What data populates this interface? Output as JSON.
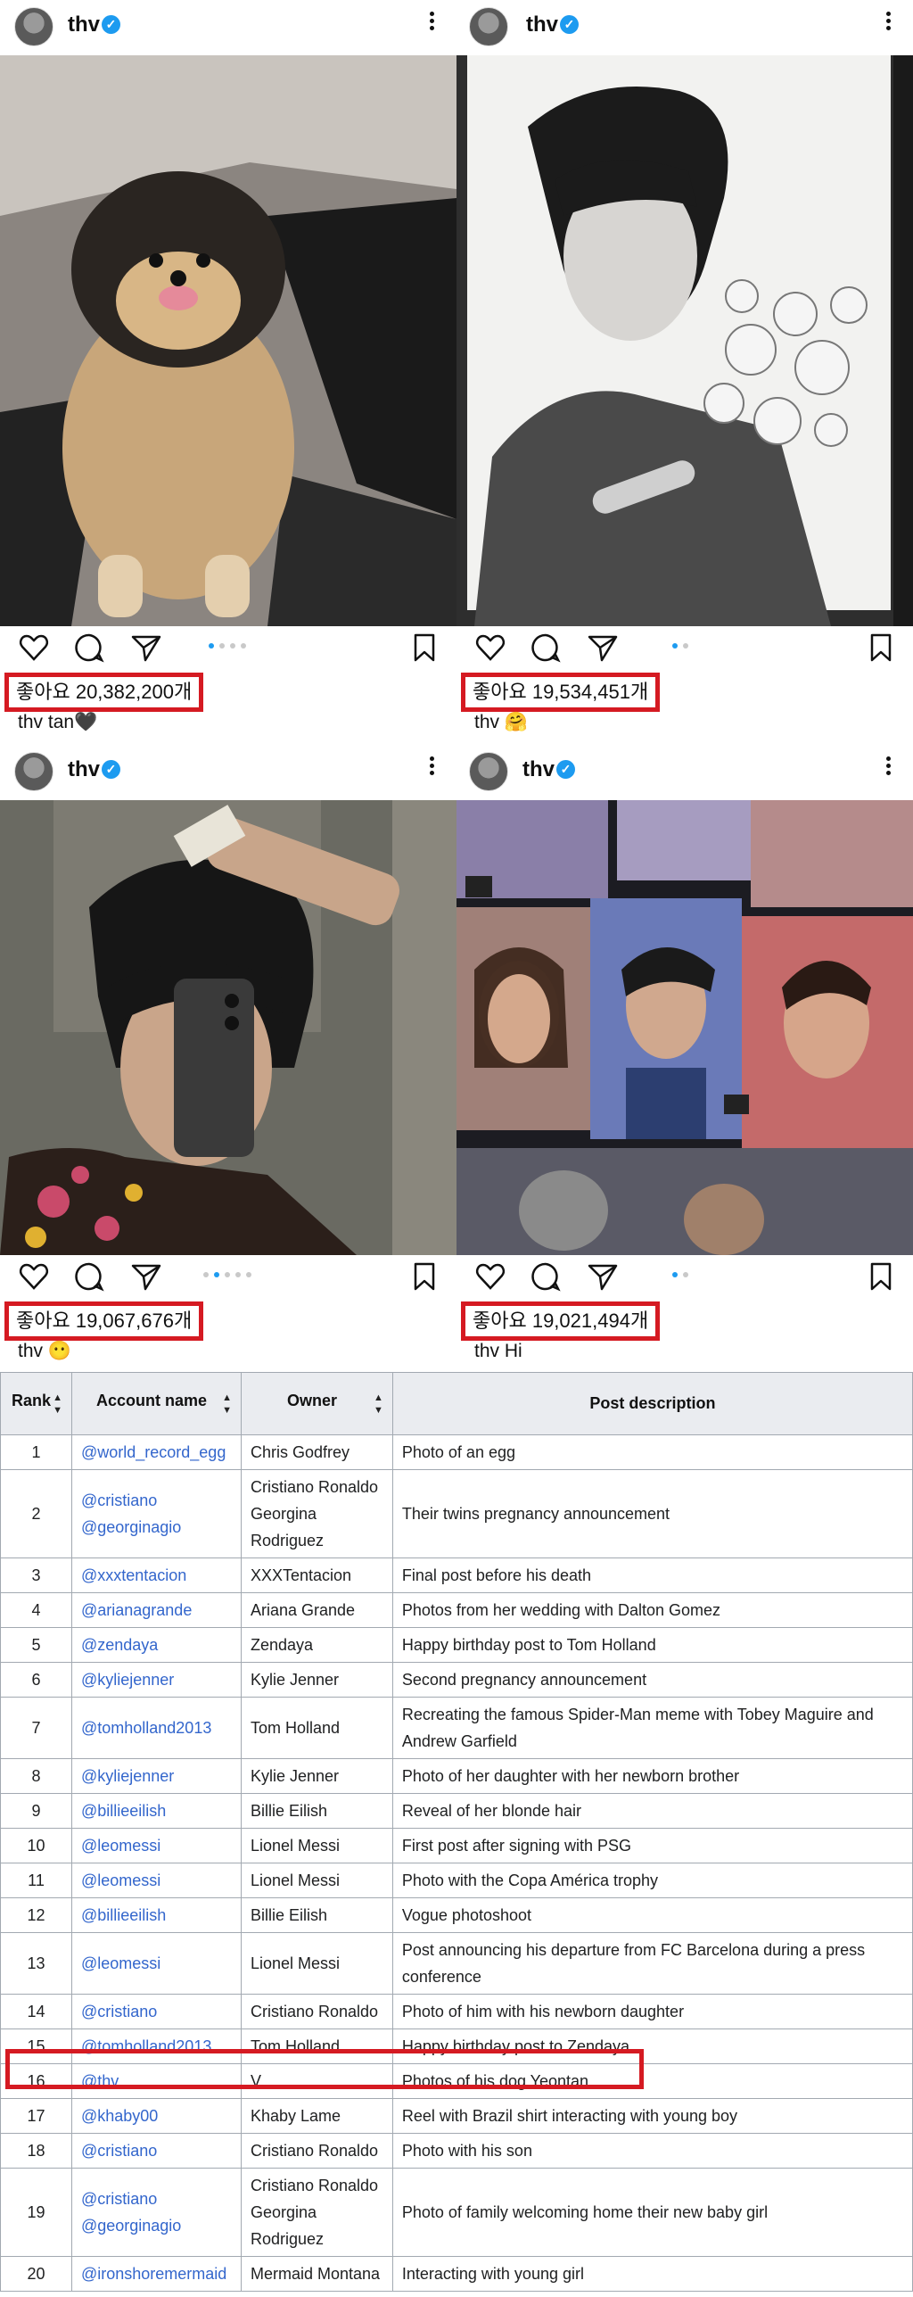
{
  "posts": [
    {
      "username": "thv",
      "likes": "좋아요 20,382,200개",
      "caption_user": "thv",
      "caption_text": "tan🖤",
      "dots": 4,
      "active_dot": 0
    },
    {
      "username": "thv",
      "likes": "좋아요 19,534,451개",
      "caption_user": "thv",
      "caption_text": "🤗",
      "dots": 2,
      "active_dot": 0
    },
    {
      "username": "thv",
      "likes": "좋아요 19,067,676개",
      "caption_user": "thv",
      "caption_text": "😶",
      "dots": 5,
      "active_dot": 1
    },
    {
      "username": "thv",
      "likes": "좋아요 19,021,494개",
      "caption_user": "thv",
      "caption_text": "Hi",
      "dots": 2,
      "active_dot": 0
    }
  ],
  "table": {
    "headers": [
      "Rank",
      "Account name",
      "Owner",
      "Post description"
    ],
    "rows": [
      {
        "rank": "1",
        "account": "@world_record_egg",
        "owner": "Chris Godfrey",
        "desc": "Photo of an egg"
      },
      {
        "rank": "2",
        "account": "@cristiano @georginagio",
        "owner": "Cristiano Ronaldo Georgina Rodriguez",
        "desc": "Their twins pregnancy announcement"
      },
      {
        "rank": "3",
        "account": "@xxxtentacion",
        "owner": "XXXTentacion",
        "desc": "Final post before his death"
      },
      {
        "rank": "4",
        "account": "@arianagrande",
        "owner": "Ariana Grande",
        "desc": "Photos from her wedding with Dalton Gomez"
      },
      {
        "rank": "5",
        "account": "@zendaya",
        "owner": "Zendaya",
        "desc": "Happy birthday post to Tom Holland"
      },
      {
        "rank": "6",
        "account": "@kyliejenner",
        "owner": "Kylie Jenner",
        "desc": "Second pregnancy announcement"
      },
      {
        "rank": "7",
        "account": "@tomholland2013",
        "owner": "Tom Holland",
        "desc": "Recreating the famous Spider-Man meme with Tobey Maguire and Andrew Garfield"
      },
      {
        "rank": "8",
        "account": "@kyliejenner",
        "owner": "Kylie Jenner",
        "desc": "Photo of her daughter with her newborn brother"
      },
      {
        "rank": "9",
        "account": "@billieeilish",
        "owner": "Billie Eilish",
        "desc": "Reveal of her blonde hair"
      },
      {
        "rank": "10",
        "account": "@leomessi",
        "owner": "Lionel Messi",
        "desc": "First post after signing with PSG"
      },
      {
        "rank": "11",
        "account": "@leomessi",
        "owner": "Lionel Messi",
        "desc": "Photo with the Copa América trophy"
      },
      {
        "rank": "12",
        "account": "@billieeilish",
        "owner": "Billie Eilish",
        "desc": "Vogue photoshoot"
      },
      {
        "rank": "13",
        "account": "@leomessi",
        "owner": "Lionel Messi",
        "desc": "Post announcing his departure from FC Barcelona during a press conference"
      },
      {
        "rank": "14",
        "account": "@cristiano",
        "owner": "Cristiano Ronaldo",
        "desc": "Photo of him with his newborn daughter"
      },
      {
        "rank": "15",
        "account": "@tomholland2013",
        "owner": "Tom Holland",
        "desc": "Happy birthday post to Zendaya"
      },
      {
        "rank": "16",
        "account": "@thv",
        "owner": "V",
        "desc": "Photos of his dog Yeontan"
      },
      {
        "rank": "17",
        "account": "@khaby00",
        "owner": "Khaby Lame",
        "desc": "Reel with Brazil shirt interacting with young boy"
      },
      {
        "rank": "18",
        "account": "@cristiano",
        "owner": "Cristiano Ronaldo",
        "desc": "Photo with his son"
      },
      {
        "rank": "19",
        "account": "@cristiano @georginagio",
        "owner": "Cristiano Ronaldo Georgina Rodriguez",
        "desc": "Photo of family welcoming home their new baby girl"
      },
      {
        "rank": "20",
        "account": "@ironshoremermaid",
        "owner": "Mermaid Montana",
        "desc": "Interacting with young girl"
      }
    ]
  },
  "colors": {
    "highlight": "#d51a22",
    "link": "#3366cc",
    "verified": "#1d9bf0"
  }
}
